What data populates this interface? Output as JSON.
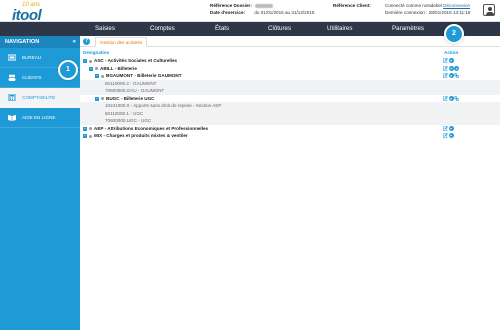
{
  "logo": {
    "small": "10 ans",
    "big": "itool"
  },
  "header": {
    "dossier_label": "Référence Dossier:",
    "exercice_label": "Date d'exercice:",
    "exercice_value": "du 01/01/2015 au 31/12/2015",
    "client_label": "Référence Client:",
    "connected_text": "Connecté comme nosidebel",
    "logout": "Déconnexion",
    "last_login": "Dernière connexion : 28/01/2016 14:11:18"
  },
  "menu": [
    "Saisies",
    "Comptes",
    "États",
    "Clôtures",
    "Utilitaires",
    "Paramètres"
  ],
  "sidebar": {
    "title": "NAVIGATION",
    "collapse_glyph": "«",
    "items": [
      {
        "label": "BUREAU",
        "icon": "desk-icon"
      },
      {
        "label": "CLIENTS",
        "icon": "clients-icon"
      },
      {
        "label": "COMPTABILITÉ",
        "icon": "calculator-icon"
      },
      {
        "label": "AIDE EN LIGNE",
        "icon": "book-icon"
      }
    ]
  },
  "badges": {
    "one": "1",
    "two": "2"
  },
  "tab": {
    "label": "Gestion des activités",
    "help": "?"
  },
  "table": {
    "col_designation": "Désignation",
    "col_action": "Action",
    "rows": [
      {
        "text": "ASC - Activités Sociales et Culturelles",
        "type": "grp",
        "level": 0,
        "actions": [
          "edit",
          "add"
        ]
      },
      {
        "text": "ABILL - Billeterie",
        "type": "grp",
        "level": 1,
        "actions": [
          "edit",
          "add",
          "delete"
        ]
      },
      {
        "text": "BGAUMONT - Billeterie GAUMONT",
        "type": "grp",
        "level": 2,
        "actions": [
          "edit",
          "delete",
          "link"
        ]
      },
      {
        "text": "60110000.2 - GAUMONT",
        "type": "acc",
        "level": 3,
        "actions": []
      },
      {
        "text": "70600000.GAU - GAUMONT",
        "type": "acc",
        "level": 3,
        "actions": []
      },
      {
        "text": "BUGC - Billeterie UGC",
        "type": "grp",
        "level": 2,
        "actions": [
          "edit",
          "delete",
          "link"
        ]
      },
      {
        "text": "10241000.0 - Apports sans droit de reprise - Section AEP",
        "type": "acc",
        "level": 3,
        "actions": []
      },
      {
        "text": "60110000.1 - UGC",
        "type": "acc",
        "level": 3,
        "actions": []
      },
      {
        "text": "70600000.UGC - UGC",
        "type": "acc",
        "level": 3,
        "actions": []
      },
      {
        "text": "AEP - Attributions Economiques et Professionnelles",
        "type": "grp",
        "level": 0,
        "actions": [
          "edit",
          "add"
        ]
      },
      {
        "text": "MIX - Charges et produits mixtes & ventiler",
        "type": "grp",
        "level": 0,
        "actions": [
          "edit",
          "add"
        ]
      }
    ]
  },
  "colors": {
    "accent": "#1e9bd7",
    "menu_bg": "#2d3747",
    "tab_text": "#e8750a"
  }
}
